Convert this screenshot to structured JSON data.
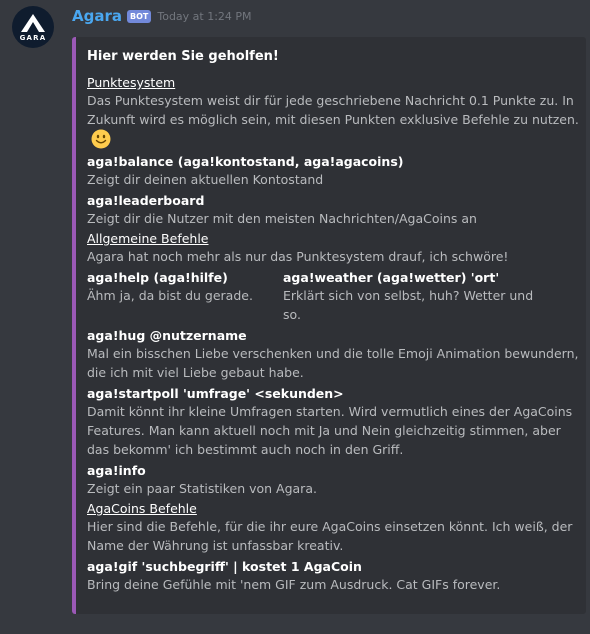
{
  "message": {
    "username": "Agara",
    "bot_tag": "BOT",
    "timestamp": "Today at 1:24 PM",
    "avatar_text": "GARA"
  },
  "embed": {
    "title": "Hier werden Sie geholfen!",
    "accent_color": "#9b59b6",
    "sections": {
      "punkte_head": "Punktesystem",
      "punkte_desc": "Das Punktesystem weist dir für jede geschriebene Nachricht 0.1 Punkte zu. In Zukunft wird es möglich sein, mit diesen Punkten exklusive Befehle zu nutzen.",
      "emoji": "slightly-smiling-face",
      "balance_cmd": "aga!balance (aga!kontostand, aga!agacoins)",
      "balance_desc": "Zeigt dir deinen aktuellen Kontostand",
      "leaderboard_cmd": "aga!leaderboard",
      "leaderboard_desc": "Zeigt dir die Nutzer mit den meisten Nachrichten/AgaCoins an",
      "allg_head": "Allgemeine Befehle",
      "allg_desc": "Agara hat noch mehr als nur das Punktesystem drauf, ich schwöre!",
      "help_cmd": "aga!help (aga!hilfe)",
      "help_desc": "Ähm ja, da bist du gerade.",
      "weather_cmd": "aga!weather (aga!wetter) 'ort'",
      "weather_desc": "Erklärt sich von selbst, huh? Wetter und so.",
      "hug_cmd": "aga!hug @nutzername",
      "hug_desc": "Mal ein bisschen Liebe verschenken und die tolle Emoji Animation bewundern, die ich mit viel Liebe gebaut habe.",
      "poll_cmd": "aga!startpoll 'umfrage' <sekunden>",
      "poll_desc": "Damit könnt ihr kleine Umfragen starten. Wird vermutlich eines der AgaCoins Features. Man kann aktuell noch mit Ja und Nein gleichzeitig stimmen, aber das bekomm' ich bestimmt auch noch in den Griff.",
      "info_cmd": "aga!info",
      "info_desc": "Zeigt ein paar Statistiken von Agara.",
      "coins_head": "AgaCoins Befehle",
      "coins_desc": "Hier sind die Befehle, für die ihr eure AgaCoins einsetzen könnt. Ich weiß, der Name der Währung ist unfassbar kreativ.",
      "gif_cmd": "aga!gif 'suchbegriff' | kostet 1 AgaCoin",
      "gif_desc": "Bring deine Gefühle mit 'nem GIF zum Ausdruck. Cat GIFs forever."
    }
  }
}
